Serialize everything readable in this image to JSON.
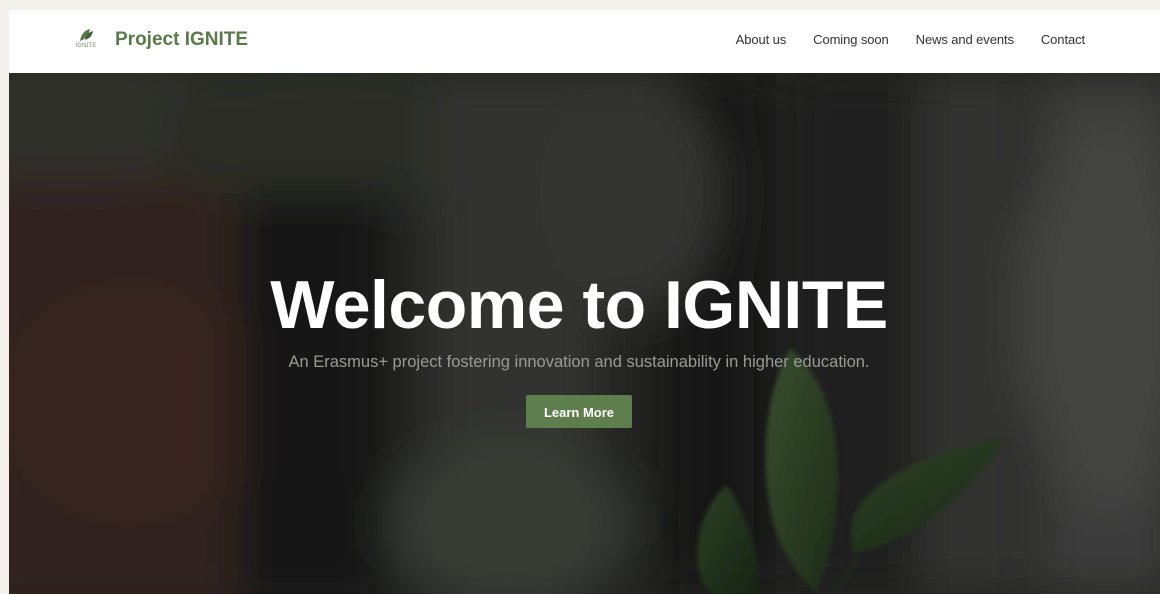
{
  "brand": {
    "logo_text": "IGNITE",
    "name": "Project IGNITE",
    "color": "#5a7a48"
  },
  "nav": {
    "items": [
      {
        "label": "About us"
      },
      {
        "label": "Coming soon"
      },
      {
        "label": "News and events"
      },
      {
        "label": "Contact"
      }
    ]
  },
  "hero": {
    "title": "Welcome to IGNITE",
    "subtitle": "An Erasmus+ project fostering innovation and sustainability in higher education.",
    "cta_label": "Learn More",
    "cta_color": "#5f7e4d"
  }
}
